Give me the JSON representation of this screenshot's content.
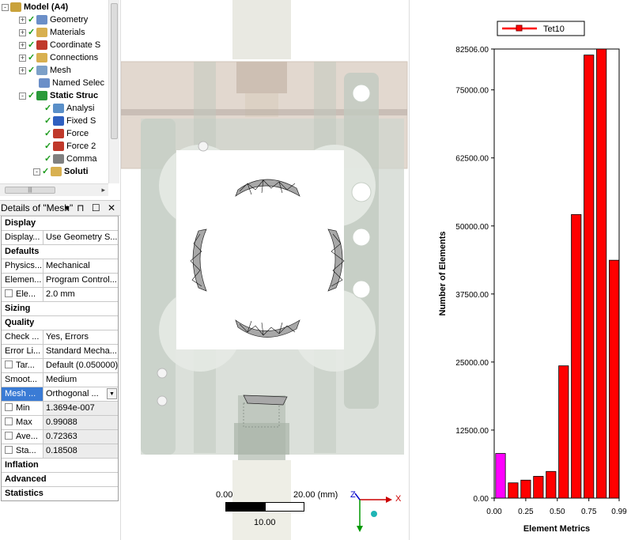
{
  "tree": {
    "items": [
      {
        "label": "Model (A4)",
        "bold": true,
        "icon": "model-icon",
        "expander": "-"
      },
      {
        "label": "Geometry",
        "icon": "geometry-icon",
        "expander": "+",
        "check": true
      },
      {
        "label": "Materials",
        "icon": "materials-icon",
        "expander": "+",
        "check": true
      },
      {
        "label": "Coordinate S",
        "icon": "coordinate-systems-icon",
        "expander": "+",
        "check": true
      },
      {
        "label": "Connections",
        "icon": "connections-icon",
        "expander": "+",
        "check": true
      },
      {
        "label": "Mesh",
        "icon": "mesh-icon",
        "expander": "+",
        "check": true
      },
      {
        "label": "Named Selec",
        "icon": "named-selections-icon",
        "expander": "",
        "check": false
      },
      {
        "label": "Static Struc",
        "bold": true,
        "icon": "static-structural-icon",
        "expander": "-",
        "check": true
      },
      {
        "label": "Analysi",
        "icon": "analysis-settings-icon",
        "check": true
      },
      {
        "label": "Fixed S",
        "icon": "fixed-support-icon",
        "check": true
      },
      {
        "label": "Force",
        "icon": "force-icon",
        "check": true
      },
      {
        "label": "Force 2",
        "icon": "force-icon",
        "check": true
      },
      {
        "label": "Comma",
        "icon": "commands-icon",
        "check": true
      },
      {
        "label": "Soluti",
        "bold": true,
        "icon": "solution-icon",
        "expander": "-",
        "check": true
      }
    ]
  },
  "details": {
    "title": "Details of \"Mesh\"",
    "header_icons": "▾ ⊓ ☐ ✕",
    "rows": [
      {
        "type": "section",
        "label": "Display"
      },
      {
        "type": "prop",
        "key": "Display...",
        "value": "Use Geometry S..."
      },
      {
        "type": "section",
        "label": "Defaults"
      },
      {
        "type": "prop",
        "key": "Physics...",
        "value": "Mechanical"
      },
      {
        "type": "prop",
        "key": "Elemen...",
        "value": "Program Control..."
      },
      {
        "type": "prop",
        "key": "Ele...",
        "value": "2.0 mm",
        "checkbox": true
      },
      {
        "type": "section",
        "label": "Sizing"
      },
      {
        "type": "section",
        "label": "Quality"
      },
      {
        "type": "prop",
        "key": "Check ...",
        "value": "Yes, Errors"
      },
      {
        "type": "prop",
        "key": "Error Li...",
        "value": "Standard Mecha..."
      },
      {
        "type": "prop",
        "key": "Tar...",
        "value": "Default (0.050000)",
        "checkbox": true
      },
      {
        "type": "prop",
        "key": "Smoot...",
        "value": "Medium"
      },
      {
        "type": "prop",
        "key": "Mesh ...",
        "value": "Orthogonal ...",
        "highlight": true,
        "dropdown": true
      },
      {
        "type": "prop",
        "key": "Min",
        "value": "1.3694e-007",
        "checkbox": true,
        "gray": true
      },
      {
        "type": "prop",
        "key": "Max",
        "value": "0.99088",
        "checkbox": true,
        "gray": true
      },
      {
        "type": "prop",
        "key": "Ave...",
        "value": "0.72363",
        "checkbox": true,
        "gray": true
      },
      {
        "type": "prop",
        "key": "Sta...",
        "value": "0.18508",
        "checkbox": true,
        "gray": true
      },
      {
        "type": "section",
        "label": "Inflation"
      },
      {
        "type": "section",
        "label": "Advanced"
      },
      {
        "type": "section",
        "label": "Statistics"
      }
    ]
  },
  "viewport": {
    "scale": {
      "left_label": "0.00",
      "right_label": "20.00 (mm)",
      "mid_label": "10.00"
    },
    "triad": {
      "x": "X",
      "z": "Z"
    }
  },
  "colors": {
    "bar": "#ff0000",
    "bar_highlight": "#ff00ff",
    "selection": "#3a7bd5",
    "check": "#1a9a1a"
  },
  "chart_data": {
    "type": "bar",
    "legend": [
      "Tet10"
    ],
    "legend_position": "top-left",
    "xlabel": "Element Metrics",
    "ylabel": "Number of Elements",
    "x_ticks": [
      "0.00",
      "0.25",
      "0.50",
      "0.75",
      "0.99"
    ],
    "x_range": [
      0.0,
      0.99
    ],
    "y_ticks": [
      "0.00",
      "12500.00",
      "25000.00",
      "37500.00",
      "50000.00",
      "62500.00",
      "75000.00",
      "82506.00"
    ],
    "ylim": [
      0,
      82506
    ],
    "bin_centers": [
      0.05,
      0.15,
      0.25,
      0.35,
      0.45,
      0.55,
      0.65,
      0.75,
      0.85,
      0.95
    ],
    "values": [
      8200,
      2800,
      3300,
      4000,
      4900,
      24300,
      52100,
      81400,
      82506,
      43700
    ],
    "highlighted_bins": [
      0
    ]
  }
}
